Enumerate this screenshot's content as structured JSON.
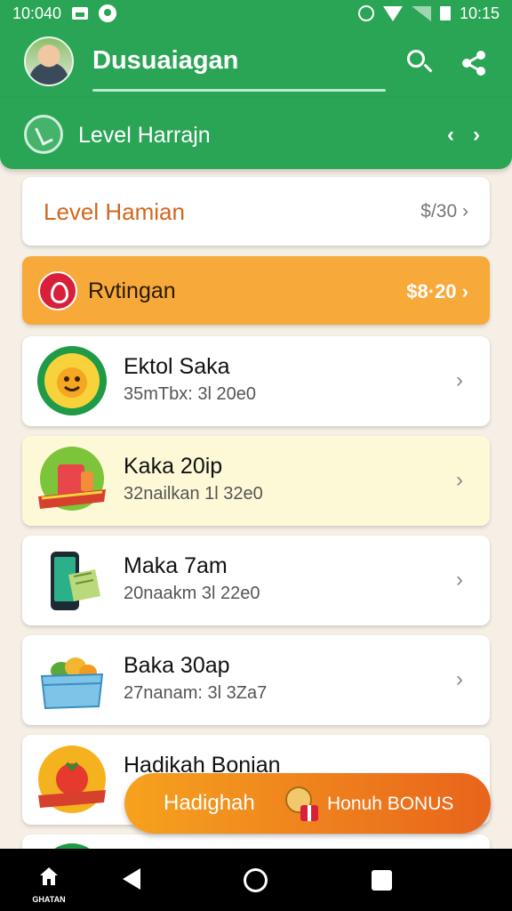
{
  "status_bar": {
    "time_left": "10:040",
    "time_right": "10:15"
  },
  "app_bar": {
    "title": "Dusuaiagan"
  },
  "level_bar": {
    "title": "Level Harrajn",
    "prev": "‹",
    "next": "›"
  },
  "level_card": {
    "label": "Level Hamian",
    "value": "$/30"
  },
  "highlight_card": {
    "label": "Rvtingan",
    "value": "$8·20"
  },
  "items": [
    {
      "title": "Ektol Saka",
      "sub": "35mTbx: 3l 20e0",
      "icon": "mascot-badge-icon"
    },
    {
      "title": "Kaka 20ip",
      "sub": "32nailkan 1l 32e0",
      "icon": "drink-badge-icon"
    },
    {
      "title": "Maka 7am",
      "sub": "20naakm 3l 22e0",
      "icon": "phone-voucher-icon"
    },
    {
      "title": "Baka 30ap",
      "sub": "27nanam: 3l 3Za7",
      "icon": "fruit-box-icon"
    },
    {
      "title": "Hadikah Bonian",
      "sub": "",
      "icon": "tomato-badge-icon"
    }
  ],
  "chevron": "›",
  "bonus": {
    "left_label": "Hadighah",
    "right_label": "Honuh BONUS"
  },
  "bottom_nav": {
    "home_label": "GHATAN"
  },
  "colors": {
    "primary_green": "#2aa455",
    "accent_orange": "#f7a939",
    "bonus_gradient_start": "#f6a21e",
    "bonus_gradient_end": "#e8641c",
    "level_text": "#d2661f"
  }
}
